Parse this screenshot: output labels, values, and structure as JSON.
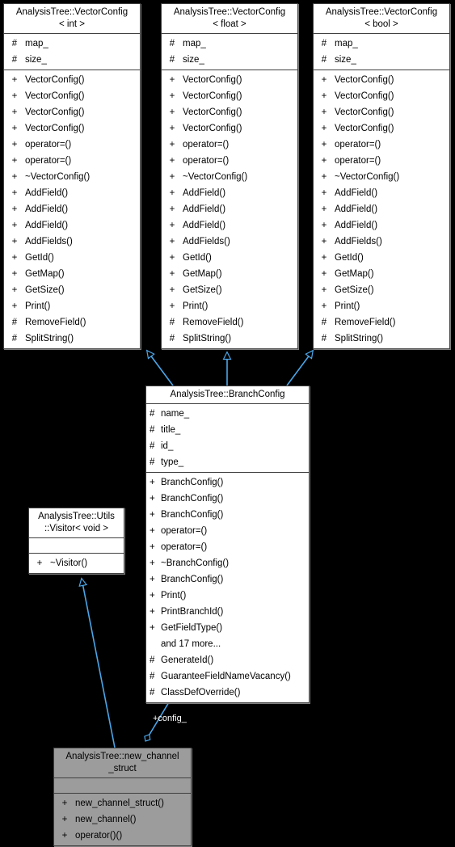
{
  "diagram": {
    "title": "AnalysisTree::BranchConfig class inheritance diagram",
    "background_color": "#000000",
    "edge_color": "#4ba6e8",
    "box_fill": "#ffffff",
    "box_shaded_fill": "#9c9c9c",
    "box_border": "#404040"
  },
  "classes": {
    "vectorconfig_int": {
      "title": "AnalysisTree::VectorConfig\n< int >",
      "attributes": [
        {
          "visibility": "#",
          "name": "map_"
        },
        {
          "visibility": "#",
          "name": "size_"
        }
      ],
      "methods": [
        {
          "visibility": "+",
          "name": "VectorConfig()"
        },
        {
          "visibility": "+",
          "name": "VectorConfig()"
        },
        {
          "visibility": "+",
          "name": "VectorConfig()"
        },
        {
          "visibility": "+",
          "name": "VectorConfig()"
        },
        {
          "visibility": "+",
          "name": "operator=()"
        },
        {
          "visibility": "+",
          "name": "operator=()"
        },
        {
          "visibility": "+",
          "name": "~VectorConfig()"
        },
        {
          "visibility": "+",
          "name": "AddField()"
        },
        {
          "visibility": "+",
          "name": "AddField()"
        },
        {
          "visibility": "+",
          "name": "AddField()"
        },
        {
          "visibility": "+",
          "name": "AddFields()"
        },
        {
          "visibility": "+",
          "name": "GetId()"
        },
        {
          "visibility": "+",
          "name": "GetMap()"
        },
        {
          "visibility": "+",
          "name": "GetSize()"
        },
        {
          "visibility": "+",
          "name": "Print()"
        },
        {
          "visibility": "#",
          "name": "RemoveField()"
        },
        {
          "visibility": "#",
          "name": "SplitString()"
        }
      ]
    },
    "vectorconfig_float": {
      "title": "AnalysisTree::VectorConfig\n< float >",
      "attributes": [
        {
          "visibility": "#",
          "name": "map_"
        },
        {
          "visibility": "#",
          "name": "size_"
        }
      ],
      "methods": [
        {
          "visibility": "+",
          "name": "VectorConfig()"
        },
        {
          "visibility": "+",
          "name": "VectorConfig()"
        },
        {
          "visibility": "+",
          "name": "VectorConfig()"
        },
        {
          "visibility": "+",
          "name": "VectorConfig()"
        },
        {
          "visibility": "+",
          "name": "operator=()"
        },
        {
          "visibility": "+",
          "name": "operator=()"
        },
        {
          "visibility": "+",
          "name": "~VectorConfig()"
        },
        {
          "visibility": "+",
          "name": "AddField()"
        },
        {
          "visibility": "+",
          "name": "AddField()"
        },
        {
          "visibility": "+",
          "name": "AddField()"
        },
        {
          "visibility": "+",
          "name": "AddFields()"
        },
        {
          "visibility": "+",
          "name": "GetId()"
        },
        {
          "visibility": "+",
          "name": "GetMap()"
        },
        {
          "visibility": "+",
          "name": "GetSize()"
        },
        {
          "visibility": "+",
          "name": "Print()"
        },
        {
          "visibility": "#",
          "name": "RemoveField()"
        },
        {
          "visibility": "#",
          "name": "SplitString()"
        }
      ]
    },
    "vectorconfig_bool": {
      "title": "AnalysisTree::VectorConfig\n< bool >",
      "attributes": [
        {
          "visibility": "#",
          "name": "map_"
        },
        {
          "visibility": "#",
          "name": "size_"
        }
      ],
      "methods": [
        {
          "visibility": "+",
          "name": "VectorConfig()"
        },
        {
          "visibility": "+",
          "name": "VectorConfig()"
        },
        {
          "visibility": "+",
          "name": "VectorConfig()"
        },
        {
          "visibility": "+",
          "name": "VectorConfig()"
        },
        {
          "visibility": "+",
          "name": "operator=()"
        },
        {
          "visibility": "+",
          "name": "operator=()"
        },
        {
          "visibility": "+",
          "name": "~VectorConfig()"
        },
        {
          "visibility": "+",
          "name": "AddField()"
        },
        {
          "visibility": "+",
          "name": "AddField()"
        },
        {
          "visibility": "+",
          "name": "AddField()"
        },
        {
          "visibility": "+",
          "name": "AddFields()"
        },
        {
          "visibility": "+",
          "name": "GetId()"
        },
        {
          "visibility": "+",
          "name": "GetMap()"
        },
        {
          "visibility": "+",
          "name": "GetSize()"
        },
        {
          "visibility": "+",
          "name": "Print()"
        },
        {
          "visibility": "#",
          "name": "RemoveField()"
        },
        {
          "visibility": "#",
          "name": "SplitString()"
        }
      ]
    },
    "branchconfig": {
      "title": "AnalysisTree::BranchConfig",
      "attributes": [
        {
          "visibility": "#",
          "name": "name_"
        },
        {
          "visibility": "#",
          "name": "title_"
        },
        {
          "visibility": "#",
          "name": "id_"
        },
        {
          "visibility": "#",
          "name": "type_"
        }
      ],
      "methods": [
        {
          "visibility": "+",
          "name": "BranchConfig()"
        },
        {
          "visibility": "+",
          "name": "BranchConfig()"
        },
        {
          "visibility": "+",
          "name": "BranchConfig()"
        },
        {
          "visibility": "+",
          "name": "operator=()"
        },
        {
          "visibility": "+",
          "name": "operator=()"
        },
        {
          "visibility": "+",
          "name": "~BranchConfig()"
        },
        {
          "visibility": "+",
          "name": "BranchConfig()"
        },
        {
          "visibility": "+",
          "name": "Print()"
        },
        {
          "visibility": "+",
          "name": "PrintBranchId()"
        },
        {
          "visibility": "+",
          "name": "GetFieldType()"
        },
        {
          "visibility": "",
          "name": "and 17 more..."
        },
        {
          "visibility": "#",
          "name": "GenerateId()"
        },
        {
          "visibility": "#",
          "name": "GuaranteeFieldNameVacancy()"
        },
        {
          "visibility": "#",
          "name": "ClassDefOverride()"
        }
      ]
    },
    "visitor": {
      "title": "AnalysisTree::Utils\n::Visitor< void >",
      "attributes": [],
      "methods": [
        {
          "visibility": "+",
          "name": "~Visitor()"
        }
      ]
    },
    "new_channel_struct": {
      "title": "AnalysisTree::new_channel\n_struct",
      "attributes": [],
      "methods": [
        {
          "visibility": "+",
          "name": "new_channel_struct()"
        },
        {
          "visibility": "+",
          "name": "new_channel()"
        },
        {
          "visibility": "+",
          "name": "operator()()"
        }
      ]
    }
  },
  "edges": [
    {
      "id": "branchconfig-to-vectorconfig-int",
      "type": "inheritance",
      "label": ""
    },
    {
      "id": "branchconfig-to-vectorconfig-float",
      "type": "inheritance",
      "label": ""
    },
    {
      "id": "branchconfig-to-vectorconfig-bool",
      "type": "inheritance",
      "label": ""
    },
    {
      "id": "new-channel-struct-to-visitor",
      "type": "inheritance",
      "label": ""
    },
    {
      "id": "new-channel-struct-to-branchconfig",
      "type": "aggregation",
      "label": "+config_"
    }
  ]
}
